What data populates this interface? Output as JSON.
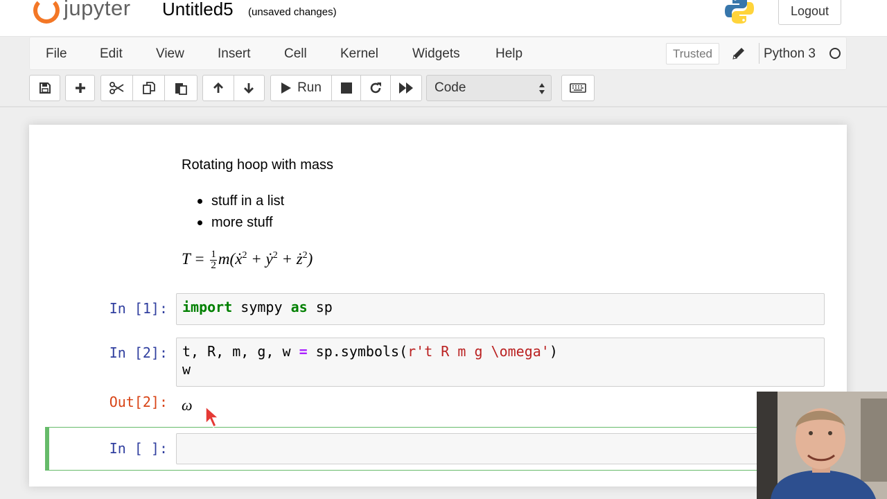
{
  "header": {
    "logo_text": "jupyter",
    "notebook_title": "Untitled5",
    "save_status": "(unsaved changes)",
    "logout_label": "Logout"
  },
  "menubar": {
    "items": [
      "File",
      "Edit",
      "View",
      "Insert",
      "Cell",
      "Kernel",
      "Widgets",
      "Help"
    ],
    "trusted_label": "Trusted",
    "kernel_name": "Python 3"
  },
  "toolbar": {
    "run_label": "Run",
    "cell_type": "Code"
  },
  "cells": {
    "markdown": {
      "heading": "Rotating hoop with mass",
      "list": [
        "stuff in a list",
        "more stuff"
      ],
      "equation": "T = ½ m(ẋ² + ẏ² + ż²)"
    },
    "cell1": {
      "prompt": "In [1]:",
      "keyword_import": "import",
      "module": "sympy",
      "keyword_as": "as",
      "alias": "sp"
    },
    "cell2": {
      "prompt": "In [2]:",
      "line1_vars": "t, R, m, g, w ",
      "line1_op": "=",
      "line1_call": " sp.symbols(",
      "line1_str": "r't R m g \\omega'",
      "line1_close": ")",
      "line2": "w",
      "out_prompt": "Out[2]:",
      "out_value": "ω"
    },
    "cell3": {
      "prompt": "In [ ]:"
    }
  },
  "colors": {
    "prompt_in": "#303f9f",
    "prompt_out": "#d84315",
    "active_border": "#66bb6a",
    "jupyter_orange": "#f37726"
  }
}
